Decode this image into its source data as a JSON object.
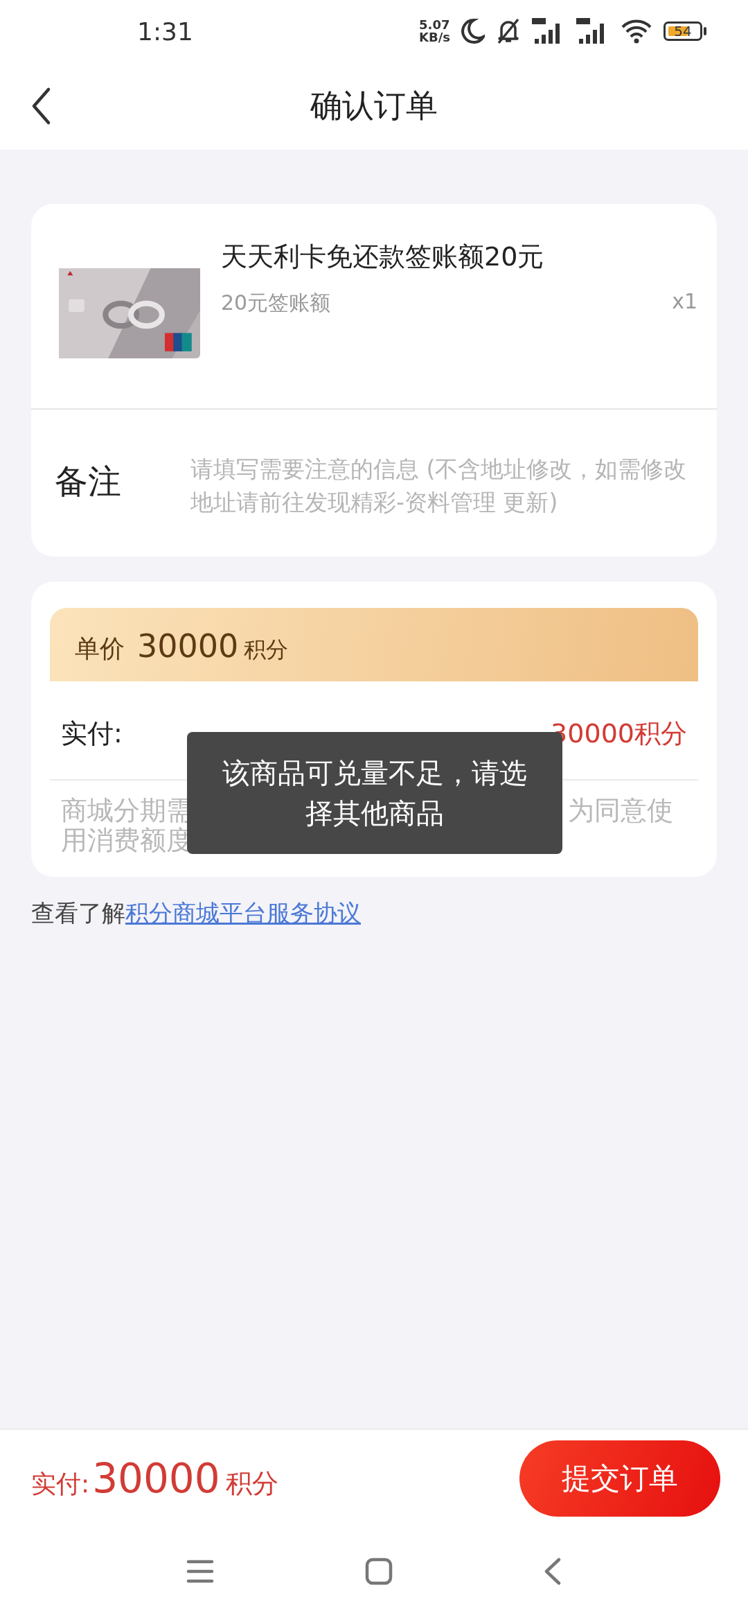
{
  "status_bar": {
    "time": "1:31",
    "net_speed": "5.07",
    "net_unit": "KB/s",
    "battery": "54"
  },
  "header": {
    "title": "确认订单"
  },
  "product": {
    "name": "天天利卡免还款签账额20元",
    "spec": "20元签账额",
    "quantity": "x1"
  },
  "remark": {
    "label": "备注",
    "placeholder": "请填写需要注意的信息 (不含地址修改，如需修改地址请前往发现精彩-资料管理 更新)"
  },
  "price": {
    "label": "单价",
    "amount": "30000",
    "unit": "积分"
  },
  "paid": {
    "label": "实付:",
    "value": "30000积分"
  },
  "notice": [
    "商城分期需",
    "为同意使",
    "用消费额度"
  ],
  "agreement": {
    "prefix": "查看了解",
    "link": "积分商城平台服务协议"
  },
  "toast": "该商品可兑量不足，请选择其他商品",
  "footer": {
    "label": "实付:",
    "amount": "30000",
    "unit": "积分",
    "button": "提交订单"
  }
}
